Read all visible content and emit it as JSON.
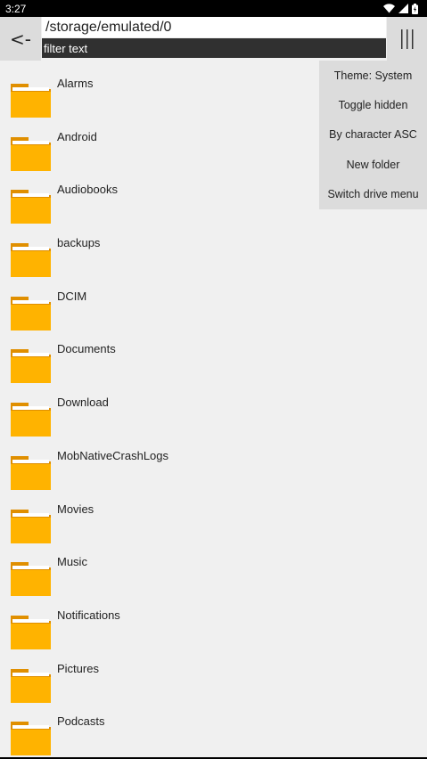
{
  "status_bar": {
    "time": "3:27"
  },
  "header": {
    "back_label": "<-",
    "path": "/storage/emulated/0",
    "filter_placeholder": "filter text"
  },
  "colors": {
    "folder_body": "#ffb300",
    "folder_tab": "#e08f00",
    "menu_bg": "#dcdcdc",
    "filter_bg": "#303030"
  },
  "files": [
    {
      "name": "Alarms",
      "icon": "folder-icon"
    },
    {
      "name": "Android",
      "icon": "folder-icon"
    },
    {
      "name": "Audiobooks",
      "icon": "folder-icon"
    },
    {
      "name": "backups",
      "icon": "folder-icon"
    },
    {
      "name": "DCIM",
      "icon": "folder-icon"
    },
    {
      "name": "Documents",
      "icon": "folder-icon"
    },
    {
      "name": "Download",
      "icon": "folder-icon"
    },
    {
      "name": "MobNativeCrashLogs",
      "icon": "folder-icon"
    },
    {
      "name": "Movies",
      "icon": "folder-icon"
    },
    {
      "name": "Music",
      "icon": "folder-icon"
    },
    {
      "name": "Notifications",
      "icon": "folder-icon"
    },
    {
      "name": "Pictures",
      "icon": "folder-icon"
    },
    {
      "name": "Podcasts",
      "icon": "folder-icon"
    }
  ],
  "menu": {
    "items": [
      {
        "label": "Theme: System"
      },
      {
        "label": "Toggle hidden"
      },
      {
        "label": "By character ASC"
      },
      {
        "label": "New folder"
      },
      {
        "label": "Switch drive menu"
      }
    ]
  }
}
